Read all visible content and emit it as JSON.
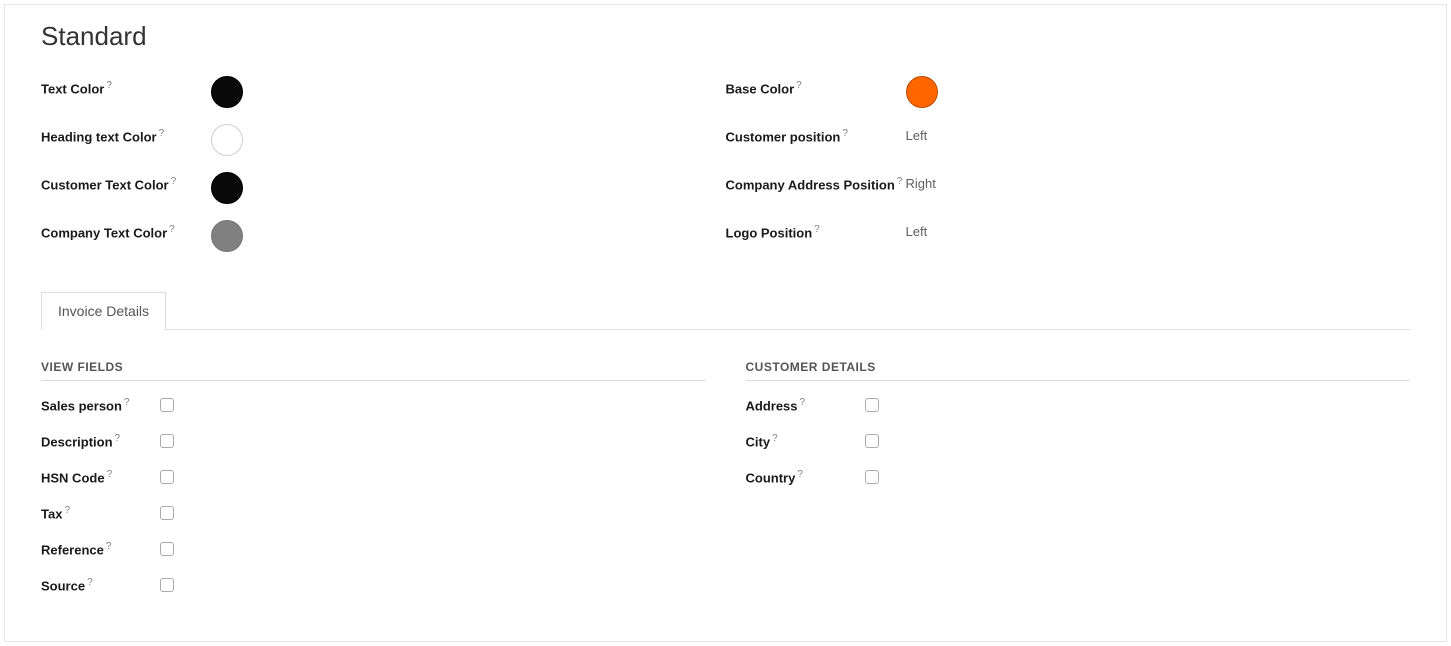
{
  "title": "Standard",
  "help_symbol": "?",
  "left_fields": {
    "text_color": {
      "label": "Text Color",
      "swatch": "black"
    },
    "heading_text_color": {
      "label": "Heading text Color",
      "swatch": "white"
    },
    "customer_text_color": {
      "label": "Customer Text Color",
      "swatch": "black"
    },
    "company_text_color": {
      "label": "Company Text Color",
      "swatch": "gray"
    }
  },
  "right_fields": {
    "base_color": {
      "label": "Base Color",
      "swatch": "orange"
    },
    "customer_position": {
      "label": "Customer position",
      "value": "Left",
      "help": true
    },
    "company_address_position": {
      "label": "Company Address Position",
      "value": "Right",
      "help": true
    },
    "logo_position": {
      "label": "Logo Position",
      "value": "Left",
      "help": true
    }
  },
  "tab_label": "Invoice Details",
  "view_fields": {
    "section_title": "VIEW FIELDS",
    "items": {
      "sales_person": {
        "label": "Sales person",
        "checked": false
      },
      "description": {
        "label": "Description",
        "checked": false
      },
      "hsn_code": {
        "label": "HSN Code",
        "checked": false
      },
      "tax": {
        "label": "Tax",
        "checked": false
      },
      "reference": {
        "label": "Reference",
        "checked": false
      },
      "source": {
        "label": "Source",
        "checked": false
      }
    }
  },
  "customer_details": {
    "section_title": "CUSTOMER DETAILS",
    "items": {
      "address": {
        "label": "Address",
        "checked": false
      },
      "city": {
        "label": "City",
        "checked": false
      },
      "country": {
        "label": "Country",
        "checked": false
      }
    }
  }
}
